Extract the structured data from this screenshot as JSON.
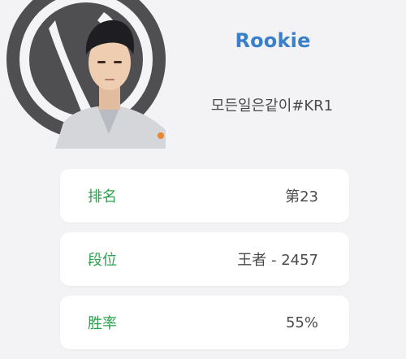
{
  "player": {
    "name": "Rookie",
    "tag": "모든일은같이#KR1"
  },
  "stats": [
    {
      "label": "排名",
      "value": "第23"
    },
    {
      "label": "段位",
      "value": "王者 - 2457"
    },
    {
      "label": "胜率",
      "value": "55%"
    }
  ],
  "colors": {
    "name": "#3a7fc9",
    "label": "#2e9f4e",
    "value": "#4b4b4b",
    "card": "#ffffff",
    "background": "#f3f3f5",
    "logo": "#4f4f52"
  }
}
